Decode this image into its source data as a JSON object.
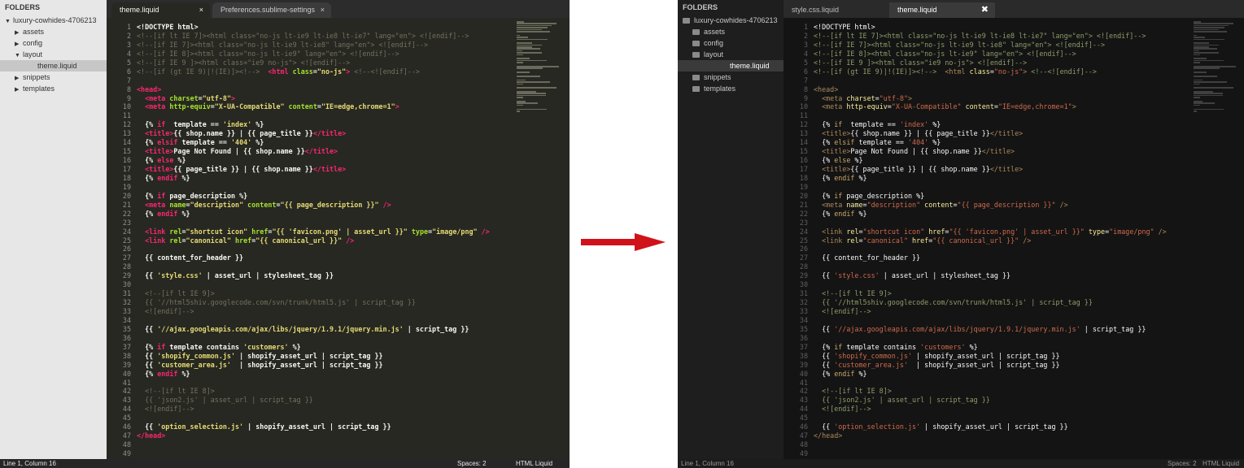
{
  "left": {
    "sidebar": {
      "header": "FOLDERS",
      "items": [
        {
          "label": "luxury-cowhides-4706213",
          "twisty": "▼",
          "indent": 0,
          "selected": false
        },
        {
          "label": "assets",
          "twisty": "▶",
          "indent": 1,
          "selected": false
        },
        {
          "label": "config",
          "twisty": "▶",
          "indent": 1,
          "selected": false
        },
        {
          "label": "layout",
          "twisty": "▼",
          "indent": 1,
          "selected": false
        },
        {
          "label": "theme.liquid",
          "twisty": "",
          "indent": 2,
          "selected": true
        },
        {
          "label": "snippets",
          "twisty": "▶",
          "indent": 1,
          "selected": false
        },
        {
          "label": "templates",
          "twisty": "▶",
          "indent": 1,
          "selected": false
        }
      ]
    },
    "tabs": [
      {
        "label": "theme.liquid",
        "close": "×",
        "active": true
      },
      {
        "label": "Preferences.sublime-settings",
        "close": "×",
        "active": false
      }
    ],
    "status": {
      "position": "Line 1, Column 16",
      "spaces": "Spaces: 2",
      "syntax": "HTML Liquid"
    }
  },
  "right": {
    "sidebar": {
      "header": "FOLDERS",
      "items": [
        {
          "label": "luxury-cowhides-4706213",
          "twisty": "folder",
          "indent": 0,
          "selected": false
        },
        {
          "label": "assets",
          "twisty": "folder",
          "indent": 1,
          "selected": false
        },
        {
          "label": "config",
          "twisty": "folder",
          "indent": 1,
          "selected": false
        },
        {
          "label": "layout",
          "twisty": "folder",
          "indent": 1,
          "selected": false
        },
        {
          "label": "theme.liquid",
          "twisty": "",
          "indent": 2,
          "selected": true
        },
        {
          "label": "snippets",
          "twisty": "folder",
          "indent": 1,
          "selected": false
        },
        {
          "label": "templates",
          "twisty": "folder",
          "indent": 1,
          "selected": false
        }
      ]
    },
    "tabs": [
      {
        "label": "style.css.liquid",
        "close": "",
        "active": false
      },
      {
        "label": "theme.liquid",
        "close": "✖",
        "active": true
      }
    ],
    "status": {
      "position": "Line 1, Column 16",
      "spaces": "Spaces: 2",
      "syntax": "HTML Liquid"
    }
  },
  "code_lines": [
    [
      [
        "",
        "<!DOCTYPE html>"
      ]
    ],
    [
      [
        "cm",
        "<!--[if lt IE 7]><html class=\"no-js lt-ie9 lt-ie8 lt-ie7\" lang=\"en\"> <![endif]-->"
      ]
    ],
    [
      [
        "cm",
        "<!--[if IE 7]><html class=\"no-js lt-ie9 lt-ie8\" lang=\"en\"> <![endif]-->"
      ]
    ],
    [
      [
        "cm",
        "<!--[if IE 8]><html class=\"no-js lt-ie9\" lang=\"en\"> <![endif]-->"
      ]
    ],
    [
      [
        "cm",
        "<!--[if IE 9 ]><html class=\"ie9 no-js\"> <![endif]-->"
      ]
    ],
    [
      [
        "cm",
        "<!--[if (gt IE 9)|!(IE)]><!-->"
      ],
      [
        "",
        "  "
      ],
      [
        "tg",
        "<html"
      ],
      [
        "at",
        " class"
      ],
      [
        "",
        "="
      ],
      [
        "st",
        "\"no-js\""
      ],
      [
        "tg",
        ">"
      ],
      [
        "cm",
        " <!--<![endif]-->"
      ]
    ],
    [],
    [
      [
        "tg",
        "<head>"
      ]
    ],
    [
      [
        "",
        "  "
      ],
      [
        "tg",
        "<meta"
      ],
      [
        "at",
        " charset"
      ],
      [
        "",
        "="
      ],
      [
        "st",
        "\"utf-8\""
      ],
      [
        "tg",
        ">"
      ]
    ],
    [
      [
        "",
        "  "
      ],
      [
        "tg",
        "<meta"
      ],
      [
        "at",
        " http-equiv"
      ],
      [
        "",
        "="
      ],
      [
        "st",
        "\"X-UA-Compatible\""
      ],
      [
        "at",
        " content"
      ],
      [
        "",
        "="
      ],
      [
        "st",
        "\"IE=edge,chrome=1\""
      ],
      [
        "tg",
        ">"
      ]
    ],
    [],
    [
      [
        "",
        "  {% "
      ],
      [
        "kw",
        "if"
      ],
      [
        "",
        "  template == "
      ],
      [
        "st",
        "'index'"
      ],
      [
        "",
        " %}"
      ]
    ],
    [
      [
        "",
        "  "
      ],
      [
        "tg",
        "<title>"
      ],
      [
        "",
        "{{ shop.name }} | {{ page_title }}"
      ],
      [
        "tg",
        "</title>"
      ]
    ],
    [
      [
        "",
        "  {% "
      ],
      [
        "kw",
        "elsif"
      ],
      [
        "",
        " template == "
      ],
      [
        "st",
        "'404'"
      ],
      [
        "",
        " %}"
      ]
    ],
    [
      [
        "",
        "  "
      ],
      [
        "tg",
        "<title>"
      ],
      [
        "",
        "Page Not Found | {{ shop.name }}"
      ],
      [
        "tg",
        "</title>"
      ]
    ],
    [
      [
        "",
        "  {% "
      ],
      [
        "kw",
        "else"
      ],
      [
        "",
        " %}"
      ]
    ],
    [
      [
        "",
        "  "
      ],
      [
        "tg",
        "<title>"
      ],
      [
        "",
        "{{ page_title }} | {{ shop.name }}"
      ],
      [
        "tg",
        "</title>"
      ]
    ],
    [
      [
        "",
        "  {% "
      ],
      [
        "kw",
        "endif"
      ],
      [
        "",
        " %}"
      ]
    ],
    [],
    [
      [
        "",
        "  {% "
      ],
      [
        "kw",
        "if"
      ],
      [
        "",
        " page_description %}"
      ]
    ],
    [
      [
        "",
        "  "
      ],
      [
        "tg",
        "<meta"
      ],
      [
        "at",
        " name"
      ],
      [
        "",
        "="
      ],
      [
        "st",
        "\"description\""
      ],
      [
        "at",
        " content"
      ],
      [
        "",
        "="
      ],
      [
        "st",
        "\"{{ page_description }}\""
      ],
      [
        "tg",
        " />"
      ]
    ],
    [
      [
        "",
        "  {% "
      ],
      [
        "kw",
        "endif"
      ],
      [
        "",
        " %}"
      ]
    ],
    [],
    [
      [
        "",
        "  "
      ],
      [
        "tg",
        "<link"
      ],
      [
        "at",
        " rel"
      ],
      [
        "",
        "="
      ],
      [
        "st",
        "\"shortcut icon\""
      ],
      [
        "at",
        " href"
      ],
      [
        "",
        "="
      ],
      [
        "st",
        "\"{{ 'favicon.png' | asset_url }}\""
      ],
      [
        "at",
        " type"
      ],
      [
        "",
        "="
      ],
      [
        "st",
        "\"image/png\""
      ],
      [
        "tg",
        " />"
      ]
    ],
    [
      [
        "",
        "  "
      ],
      [
        "tg",
        "<link"
      ],
      [
        "at",
        " rel"
      ],
      [
        "",
        "="
      ],
      [
        "st",
        "\"canonical\""
      ],
      [
        "at",
        " href"
      ],
      [
        "",
        "="
      ],
      [
        "st",
        "\"{{ canonical_url }}\""
      ],
      [
        "tg",
        " />"
      ]
    ],
    [],
    [
      [
        "",
        "  {{ content_for_header }}"
      ]
    ],
    [],
    [
      [
        "",
        "  {{ "
      ],
      [
        "st",
        "'style.css'"
      ],
      [
        "",
        " | asset_url | stylesheet_tag }}"
      ]
    ],
    [],
    [
      [
        "",
        "  "
      ],
      [
        "cm",
        "<!--[if lt IE 9]>"
      ]
    ],
    [
      [
        "",
        "  "
      ],
      [
        "cm",
        "{{ '//html5shiv.googlecode.com/svn/trunk/html5.js' | script_tag }}"
      ]
    ],
    [
      [
        "",
        "  "
      ],
      [
        "cm",
        "<![endif]-->"
      ]
    ],
    [],
    [
      [
        "",
        "  {{ "
      ],
      [
        "st",
        "'//ajax.googleapis.com/ajax/libs/jquery/1.9.1/jquery.min.js'"
      ],
      [
        "",
        " | script_tag }}"
      ]
    ],
    [],
    [
      [
        "",
        "  {% "
      ],
      [
        "kw",
        "if"
      ],
      [
        "",
        " template contains "
      ],
      [
        "st",
        "'customers'"
      ],
      [
        "",
        " %}"
      ]
    ],
    [
      [
        "",
        "  {{ "
      ],
      [
        "st",
        "'shopify_common.js'"
      ],
      [
        "",
        " | shopify_asset_url | script_tag }}"
      ]
    ],
    [
      [
        "",
        "  {{ "
      ],
      [
        "st",
        "'customer_area.js'"
      ],
      [
        "",
        "  | shopify_asset_url | script_tag }}"
      ]
    ],
    [
      [
        "",
        "  {% "
      ],
      [
        "kw",
        "endif"
      ],
      [
        "",
        " %}"
      ]
    ],
    [],
    [
      [
        "",
        "  "
      ],
      [
        "cm",
        "<!--[if lt IE 8]>"
      ]
    ],
    [
      [
        "",
        "  "
      ],
      [
        "cm",
        "{{ 'json2.js' | asset_url | script_tag }}"
      ]
    ],
    [
      [
        "",
        "  "
      ],
      [
        "cm",
        "<![endif]-->"
      ]
    ],
    [],
    [
      [
        "",
        "  {{ "
      ],
      [
        "st",
        "'option_selection.js'"
      ],
      [
        "",
        " | shopify_asset_url | script_tag }}"
      ]
    ],
    [
      [
        "tg",
        "</head>"
      ]
    ],
    [],
    []
  ],
  "colors": {
    "arrow": "#d0121b"
  }
}
